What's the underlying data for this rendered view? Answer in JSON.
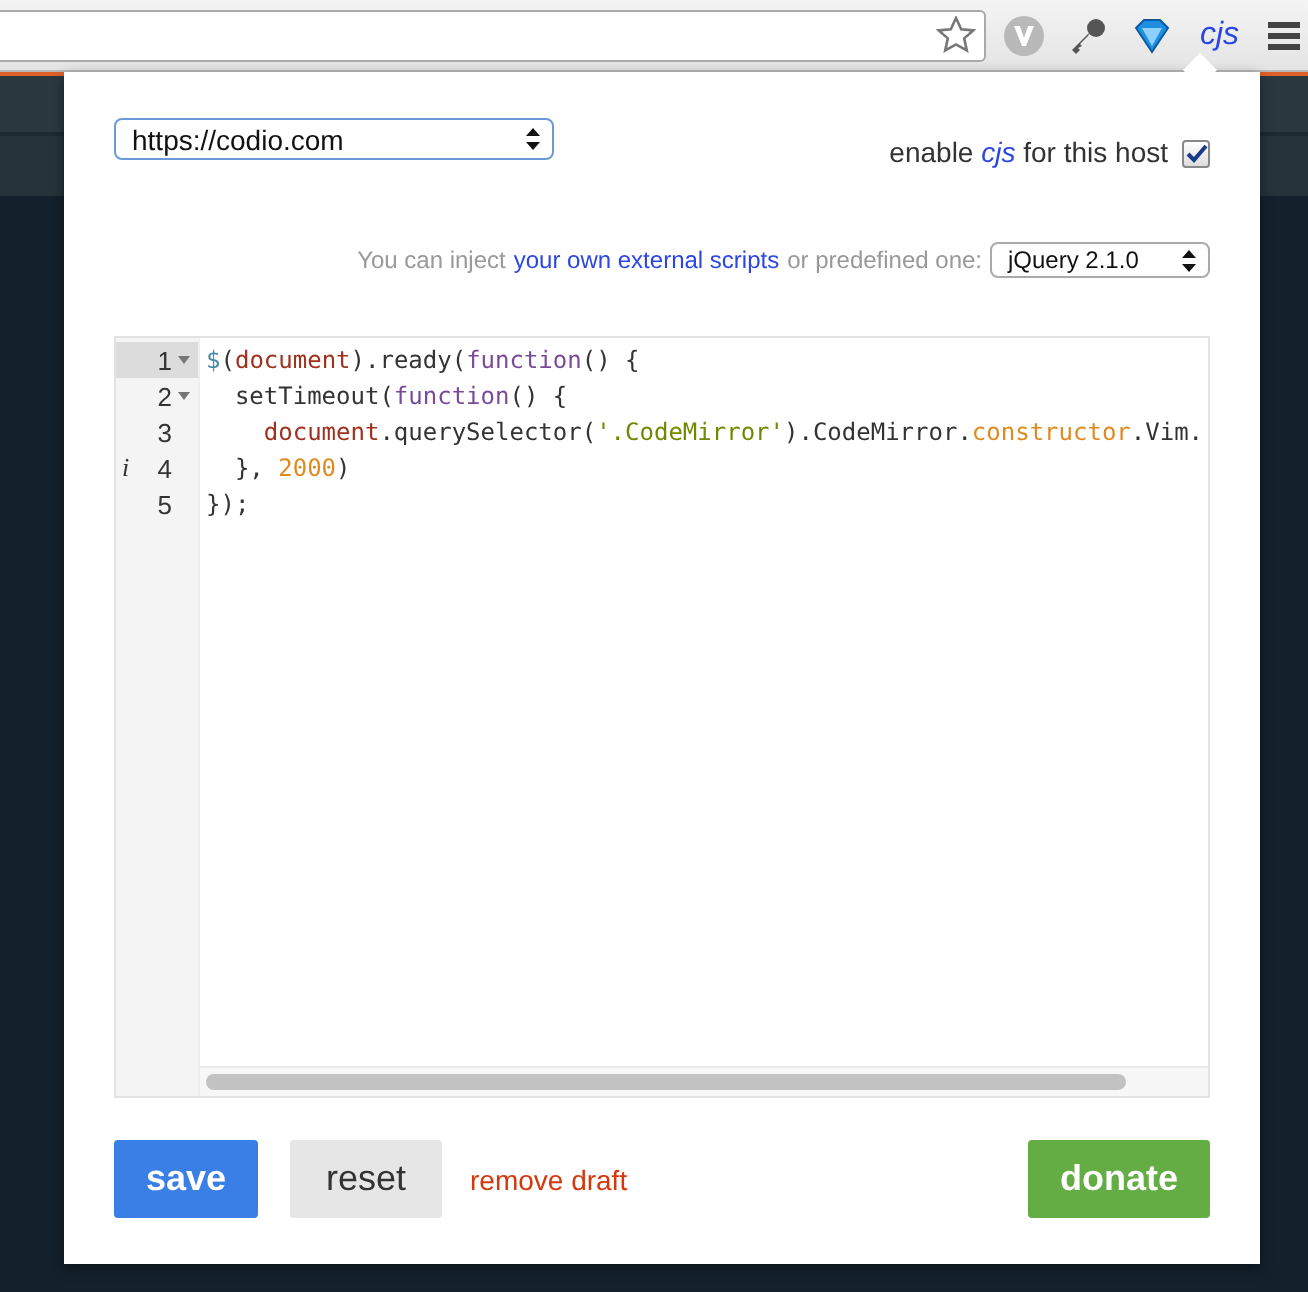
{
  "toolbar": {
    "extension_label": "cjs"
  },
  "host_select": {
    "value": "https://codio.com"
  },
  "enable": {
    "prefix": "enable",
    "name": "cjs",
    "suffix": "for this host",
    "checked": true
  },
  "inject": {
    "prefix": "You can inject",
    "link": "your own external scripts",
    "suffix": "or predefined one:",
    "library": "jQuery 2.1.0"
  },
  "editor": {
    "lines": [
      {
        "number": "1",
        "fold": true,
        "active": true,
        "tokens": [
          {
            "text": "$",
            "kind": "dollar"
          },
          {
            "text": "(",
            "kind": "plain"
          },
          {
            "text": "document",
            "kind": "variable"
          },
          {
            "text": ").ready(",
            "kind": "plain"
          },
          {
            "text": "function",
            "kind": "keyword"
          },
          {
            "text": "() {",
            "kind": "plain"
          }
        ]
      },
      {
        "number": "2",
        "fold": true,
        "active": false,
        "tokens": [
          {
            "text": "  setTimeout(",
            "kind": "plain"
          },
          {
            "text": "function",
            "kind": "keyword"
          },
          {
            "text": "() {",
            "kind": "plain"
          }
        ]
      },
      {
        "number": "3",
        "fold": false,
        "active": false,
        "tokens": [
          {
            "text": "    document",
            "kind": "variable"
          },
          {
            "text": ".querySelector(",
            "kind": "plain"
          },
          {
            "text": "'.CodeMirror'",
            "kind": "string"
          },
          {
            "text": ").CodeMirror.",
            "kind": "plain"
          },
          {
            "text": "constructor",
            "kind": "property"
          },
          {
            "text": ".Vim.",
            "kind": "plain"
          }
        ]
      },
      {
        "number": "4",
        "fold": false,
        "active": false,
        "marker": "i",
        "tokens": [
          {
            "text": "  }, ",
            "kind": "plain"
          },
          {
            "text": "2000",
            "kind": "number"
          },
          {
            "text": ")",
            "kind": "plain"
          }
        ]
      },
      {
        "number": "5",
        "fold": false,
        "active": false,
        "tokens": [
          {
            "text": "});",
            "kind": "plain"
          }
        ]
      }
    ]
  },
  "buttons": [
    {
      "label": "save",
      "kind": "primary"
    },
    {
      "label": "reset",
      "kind": "secondary"
    },
    {
      "label": "remove draft",
      "kind": "link"
    },
    {
      "label": "donate",
      "kind": "donate"
    }
  ]
}
